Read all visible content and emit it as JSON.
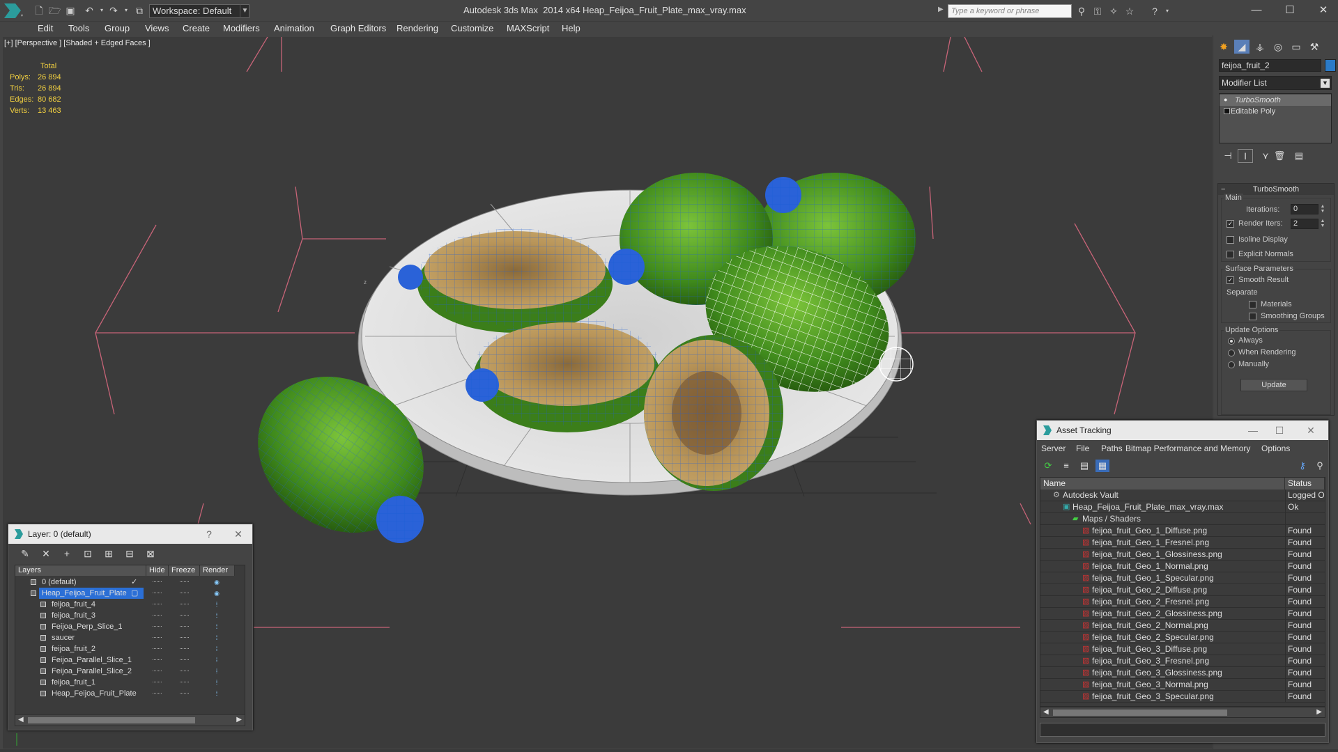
{
  "titlebar": {
    "workspace": "Workspace: Default",
    "app_title": "Autodesk 3ds Max  2014 x64",
    "doc_title": "Heap_Feijoa_Fruit_Plate_max_vray.max",
    "search_placeholder": "Type a keyword or phrase",
    "window_buttons": [
      "—",
      "☐",
      "✕"
    ]
  },
  "menubar": [
    "Edit",
    "Tools",
    "Group",
    "Views",
    "Create",
    "Modifiers",
    "Animation",
    "Graph Editors",
    "Rendering",
    "Customize",
    "MAXScript",
    "Help"
  ],
  "viewport": {
    "label": "[+] [Perspective ] [Shaded + Edged Faces ]",
    "stats": {
      "header": "Total",
      "rows": [
        {
          "label": "Polys:",
          "value": "26 894"
        },
        {
          "label": "Tris:",
          "value": "26 894"
        },
        {
          "label": "Edges:",
          "value": "80 682"
        },
        {
          "label": "Verts:",
          "value": "13 463"
        }
      ]
    },
    "gizmo_label": "z"
  },
  "command_panel": {
    "object_name": "feijoa_fruit_2",
    "object_color": "#2b7bc8",
    "modifier_list": "Modifier List",
    "stack": [
      "TurboSmooth",
      "Editable Poly"
    ],
    "rollout_title": "TurboSmooth",
    "main_group": "Main",
    "iterations_label": "Iterations:",
    "iterations_value": "0",
    "render_iters_label": "Render Iters:",
    "render_iters_value": "2",
    "render_iters_checked": true,
    "isoline_label": "Isoline Display",
    "explicit_normals_label": "Explicit Normals",
    "surface_group": "Surface Parameters",
    "smooth_result_label": "Smooth Result",
    "smooth_result_checked": true,
    "separate_label": "Separate",
    "materials_label": "Materials",
    "smoothing_groups_label": "Smoothing Groups",
    "update_group": "Update Options",
    "always_label": "Always",
    "when_rendering_label": "When Rendering",
    "manually_label": "Manually",
    "update_button": "Update"
  },
  "layer_dialog": {
    "title": "Layer: 0 (default)",
    "help": "?",
    "close": "✕",
    "columns": [
      "Layers",
      "Hide",
      "Freeze",
      "Render"
    ],
    "rows": [
      {
        "name": "0 (default)",
        "level": 0,
        "selected": false,
        "current": true
      },
      {
        "name": "Heap_Feijoa_Fruit_Plate",
        "level": 0,
        "selected": true,
        "current": false
      },
      {
        "name": "feijoa_fruit_4",
        "level": 1,
        "selected": false,
        "current": false
      },
      {
        "name": "feijoa_fruit_3",
        "level": 1,
        "selected": false,
        "current": false
      },
      {
        "name": "Feijoa_Perp_Slice_1",
        "level": 1,
        "selected": false,
        "current": false
      },
      {
        "name": "saucer",
        "level": 1,
        "selected": false,
        "current": false
      },
      {
        "name": "feijoa_fruit_2",
        "level": 1,
        "selected": false,
        "current": false
      },
      {
        "name": "Feijoa_Parallel_Slice_1",
        "level": 1,
        "selected": false,
        "current": false
      },
      {
        "name": "Feijoa_Parallel_Slice_2",
        "level": 1,
        "selected": false,
        "current": false
      },
      {
        "name": "feijoa_fruit_1",
        "level": 1,
        "selected": false,
        "current": false
      },
      {
        "name": "Heap_Feijoa_Fruit_Plate",
        "level": 1,
        "selected": false,
        "current": false
      }
    ]
  },
  "asset_tracking": {
    "title": "Asset Tracking",
    "window_buttons": [
      "—",
      "☐",
      "✕"
    ],
    "menu": [
      "Server",
      "File",
      "Paths",
      "Bitmap Performance and Memory",
      "Options"
    ],
    "columns": [
      "Name",
      "Status"
    ],
    "rows": [
      {
        "name": "Autodesk Vault",
        "status": "Logged O",
        "level": 0,
        "icon": "vault"
      },
      {
        "name": "Heap_Feijoa_Fruit_Plate_max_vray.max",
        "status": "Ok",
        "level": 1,
        "icon": "max-file"
      },
      {
        "name": "Maps / Shaders",
        "status": "",
        "level": 2,
        "icon": "maps"
      },
      {
        "name": "feijoa_fruit_Geo_1_Diffuse.png",
        "status": "Found",
        "level": 3,
        "icon": "png"
      },
      {
        "name": "feijoa_fruit_Geo_1_Fresnel.png",
        "status": "Found",
        "level": 3,
        "icon": "png"
      },
      {
        "name": "feijoa_fruit_Geo_1_Glossiness.png",
        "status": "Found",
        "level": 3,
        "icon": "png"
      },
      {
        "name": "feijoa_fruit_Geo_1_Normal.png",
        "status": "Found",
        "level": 3,
        "icon": "png"
      },
      {
        "name": "feijoa_fruit_Geo_1_Specular.png",
        "status": "Found",
        "level": 3,
        "icon": "png"
      },
      {
        "name": "feijoa_fruit_Geo_2_Diffuse.png",
        "status": "Found",
        "level": 3,
        "icon": "png"
      },
      {
        "name": "feijoa_fruit_Geo_2_Fresnel.png",
        "status": "Found",
        "level": 3,
        "icon": "png"
      },
      {
        "name": "feijoa_fruit_Geo_2_Glossiness.png",
        "status": "Found",
        "level": 3,
        "icon": "png"
      },
      {
        "name": "feijoa_fruit_Geo_2_Normal.png",
        "status": "Found",
        "level": 3,
        "icon": "png"
      },
      {
        "name": "feijoa_fruit_Geo_2_Specular.png",
        "status": "Found",
        "level": 3,
        "icon": "png"
      },
      {
        "name": "feijoa_fruit_Geo_3_Diffuse.png",
        "status": "Found",
        "level": 3,
        "icon": "png"
      },
      {
        "name": "feijoa_fruit_Geo_3_Fresnel.png",
        "status": "Found",
        "level": 3,
        "icon": "png"
      },
      {
        "name": "feijoa_fruit_Geo_3_Glossiness.png",
        "status": "Found",
        "level": 3,
        "icon": "png"
      },
      {
        "name": "feijoa_fruit_Geo_3_Normal.png",
        "status": "Found",
        "level": 3,
        "icon": "png"
      },
      {
        "name": "feijoa_fruit_Geo_3_Specular.png",
        "status": "Found",
        "level": 3,
        "icon": "png"
      }
    ]
  },
  "colors": {
    "selection": "#2b6fd6",
    "stats_text": "#f2d040",
    "wire_blue": "#1f5fd6",
    "fruit_green": "#3f8a1c",
    "flesh": "#b09050",
    "plate": "#d4d4d4"
  }
}
